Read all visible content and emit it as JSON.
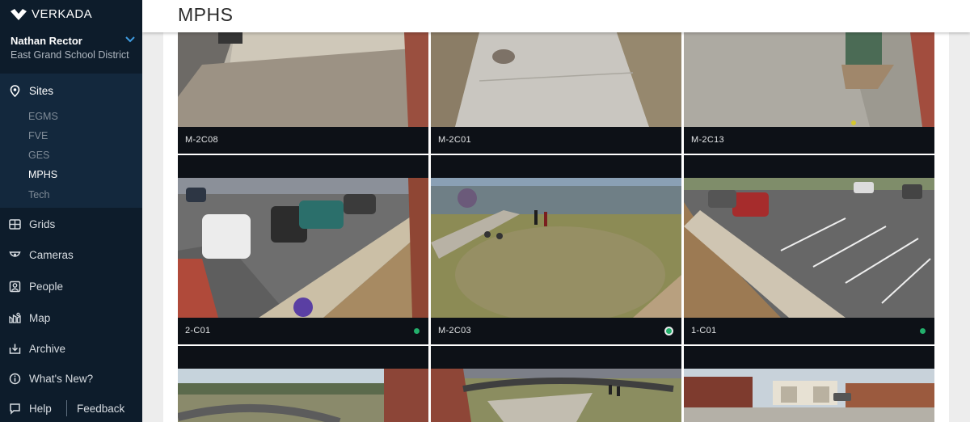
{
  "brand": {
    "name": "VERKADA"
  },
  "user": {
    "name": "Nathan Rector",
    "org": "East Grand School District"
  },
  "nav": {
    "sites_label": "Sites",
    "sites": [
      "EGMS",
      "FVE",
      "GES",
      "MPHS",
      "Tech"
    ],
    "active_site": "MPHS",
    "grids_label": "Grids",
    "cameras_label": "Cameras",
    "people_label": "People",
    "map_label": "Map",
    "archive_label": "Archive",
    "whats_new_label": "What's New?",
    "help_label": "Help",
    "feedback_label": "Feedback"
  },
  "page": {
    "title": "MPHS"
  },
  "cameras": [
    {
      "name": "M-2C08",
      "status": ""
    },
    {
      "name": "M-2C01",
      "status": ""
    },
    {
      "name": "M-2C13",
      "status": ""
    },
    {
      "name": "2-C01",
      "status": "online"
    },
    {
      "name": "M-2C03",
      "status": "online-selected"
    },
    {
      "name": "1-C01",
      "status": "online"
    },
    {
      "name": "",
      "status": ""
    },
    {
      "name": "",
      "status": ""
    },
    {
      "name": "",
      "status": ""
    }
  ],
  "colors": {
    "sidebar": "#0d1c2b",
    "sites_panel": "#13283d",
    "online": "#23b06c"
  }
}
